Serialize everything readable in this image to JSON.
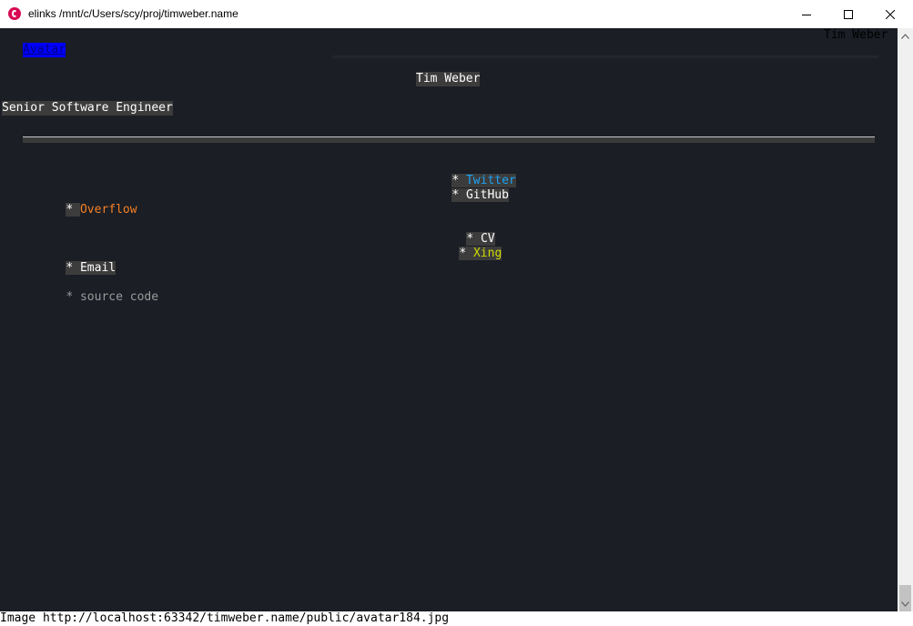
{
  "window": {
    "title": "elinks  /mnt/c/Users/scy/proj/timweber.name",
    "icons": {
      "app": "debian-swirl-icon",
      "minimize": "minimize-icon",
      "maximize": "maximize-icon",
      "close": "close-icon"
    }
  },
  "page": {
    "header_title": "Tim Weber",
    "avatar_link": "Avatar",
    "name": "Tim Weber",
    "subtitle": "Senior Software Engineer",
    "links": {
      "twitter": "Twitter",
      "github": "GitHub",
      "overflow": "Overflow",
      "cv": "CV",
      "xing": "Xing",
      "email": "Email",
      "source": "source code"
    },
    "bullet": "* "
  },
  "status": {
    "text": "Image http://localhost:63342/timweber.name/public/avatar184.jpg"
  },
  "colors": {
    "background": "#1b1e25",
    "link_highlight": "#0000ff",
    "twitter": "#1da1f2",
    "overflow": "#f48024",
    "xing": "#cfdc00",
    "text": "#ffffff",
    "muted": "#9a9a9a"
  }
}
